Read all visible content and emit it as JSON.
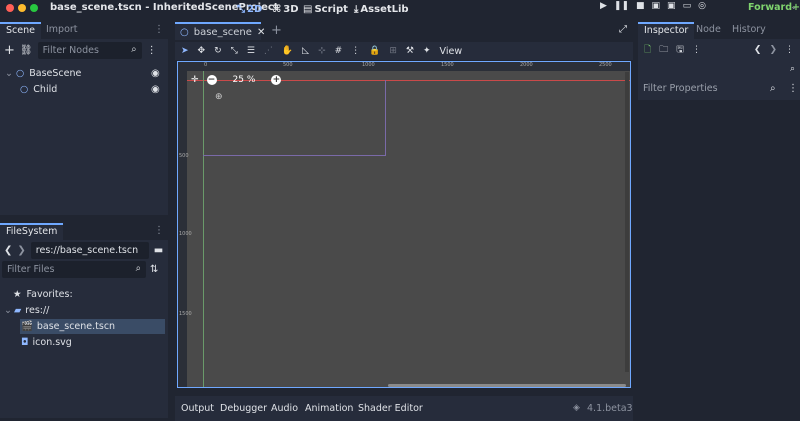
{
  "window": {
    "title": "base_scene.tscn - InheritedSceneProject",
    "modes": [
      {
        "label": "2D",
        "icon": "2d-icon"
      },
      {
        "label": "3D",
        "icon": "3d-icon"
      },
      {
        "label": "Script",
        "icon": "script-icon"
      },
      {
        "label": "AssetLib",
        "icon": "assetlib-icon"
      }
    ],
    "renderer": "Forward+"
  },
  "scene_dock": {
    "tabs": [
      "Scene",
      "Import"
    ],
    "filter_placeholder": "Filter Nodes",
    "nodes": [
      {
        "name": "BaseScene",
        "icon": "node2d-icon",
        "level": 0
      },
      {
        "name": "Child",
        "icon": "node2d-icon",
        "level": 1
      }
    ]
  },
  "filesystem_dock": {
    "tabs": [
      "FileSystem"
    ],
    "path": "res://base_scene.tscn",
    "filter_placeholder": "Filter Files",
    "favorites_label": "Favorites:",
    "root": "res://",
    "files": [
      {
        "name": "base_scene.tscn",
        "icon": "scene-file-icon",
        "selected": true
      },
      {
        "name": "icon.svg",
        "icon": "image-file-icon",
        "selected": false
      }
    ]
  },
  "editor": {
    "tabs": [
      {
        "label": "base_scene",
        "active": true
      }
    ],
    "toolbar_view_label": "View",
    "zoom": "25 %",
    "ruler_top": [
      "0",
      "500",
      "1000",
      "1500",
      "2000",
      "2500"
    ],
    "ruler_left": [
      "500",
      "1000",
      "1500"
    ]
  },
  "inspector_dock": {
    "tabs": [
      "Inspector",
      "Node",
      "History"
    ],
    "filter_placeholder": "Filter Properties"
  },
  "bottom_panel": {
    "tabs": [
      "Output",
      "Debugger",
      "Audio",
      "Animation",
      "Shader Editor"
    ],
    "version": "4.1.beta3"
  },
  "colors": {
    "accent": "#6fa8ff",
    "viewport_bg": "#4a4a4a",
    "background": "#202531",
    "panel": "#262c3b"
  }
}
